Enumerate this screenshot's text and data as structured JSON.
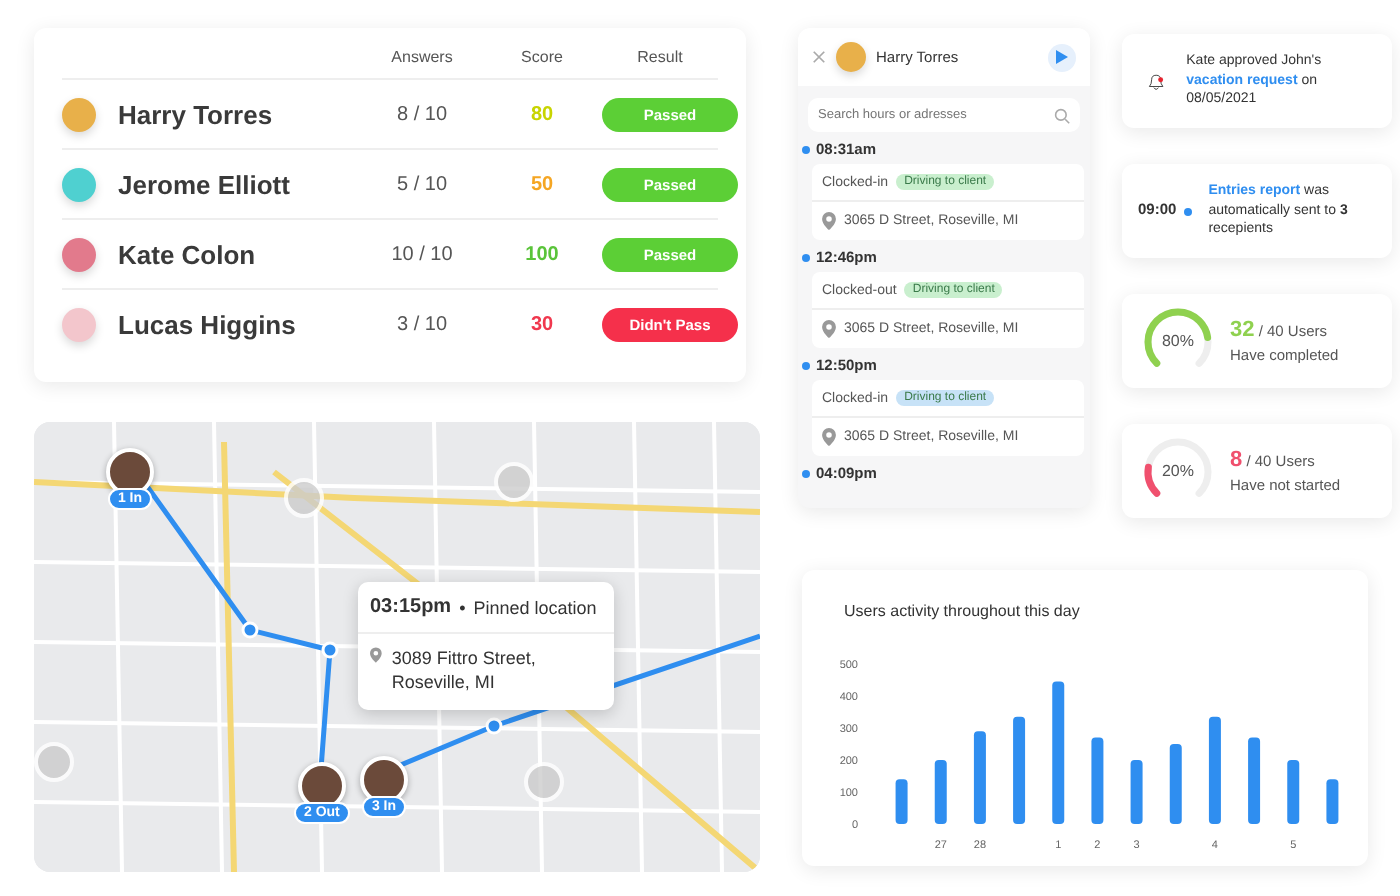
{
  "results_table": {
    "columns": [
      "Answers",
      "Score",
      "Result"
    ],
    "rows": [
      {
        "name": "Harry Torres",
        "answers": "8 / 10",
        "score": "80",
        "color": "#c8d400",
        "result": "Passed",
        "passed": true
      },
      {
        "name": "Jerome Elliott",
        "answers": "5 / 10",
        "score": "50",
        "color": "#f5a623",
        "result": "Passed",
        "passed": true
      },
      {
        "name": "Kate Colon",
        "answers": "10 / 10",
        "score": "100",
        "color": "#5ac43a",
        "result": "Passed",
        "passed": true
      },
      {
        "name": "Lucas Higgins",
        "answers": "3 / 10",
        "score": "30",
        "color": "#f0384e",
        "result": "Didn't Pass",
        "passed": false
      }
    ]
  },
  "map": {
    "markers": [
      {
        "label": "1 In"
      },
      {
        "label": "2 Out"
      },
      {
        "label": "3 In"
      }
    ],
    "popup": {
      "time": "03:15pm",
      "separator": "•",
      "title": "Pinned location",
      "address": "3089  Fittro Street, Roseville, MI"
    }
  },
  "timeline": {
    "user": "Harry Torres",
    "search": {
      "placeholder": "Search hours or adresses"
    },
    "entries": [
      {
        "time": "08:31am",
        "status": "Clocked-in",
        "tag": "Driving to client",
        "color": "#c9efce",
        "address": "3065  D Street, Roseville, MI"
      },
      {
        "time": "12:46pm",
        "status": "Clocked-out",
        "tag": "Driving to client",
        "color": "#c9efce",
        "address": "3065  D Street, Roseville, MI"
      },
      {
        "time": "12:50pm",
        "status": "Clocked-in",
        "tag": "Driving to client",
        "color": "#c7e2f7",
        "address": "3065  D Street, Roseville, MI"
      },
      {
        "time": "04:09pm"
      }
    ]
  },
  "notification": {
    "before": "Kate approved John's",
    "link": "vacation request",
    "after": "on 08/05/2021"
  },
  "report": {
    "time": "09:00",
    "link": "Entries report",
    "text": "was automatically sent to **3** recepients"
  },
  "progress": [
    {
      "label": "80%",
      "level": 0.8,
      "color": "#8fd14f",
      "count": "32",
      "total": "/ 40 Users",
      "caption": "Have completed"
    },
    {
      "label": "20%",
      "level": 0.2,
      "color": "#f0506e",
      "count": "8",
      "total": "/ 40 Users",
      "caption": "Have not started"
    }
  ],
  "activity": {
    "chart_data": {
      "type": "bar",
      "title": "Users activity throughout this day",
      "categories": [
        null,
        "27",
        "28",
        null,
        "1",
        "2",
        "3",
        null,
        "4",
        null,
        "5",
        null
      ],
      "values": [
        140,
        200,
        290,
        335,
        445,
        270,
        200,
        250,
        335,
        270,
        200,
        140
      ],
      "ylim": [
        0,
        500
      ],
      "yticks": [
        0,
        100,
        200,
        300,
        400,
        500
      ]
    }
  }
}
